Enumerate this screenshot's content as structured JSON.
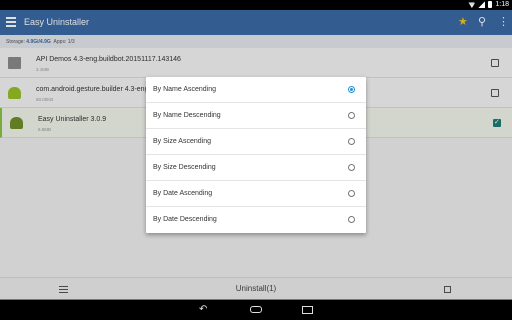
{
  "status_bar": {
    "time": "1:18"
  },
  "app_bar": {
    "title": "Easy Uninstaller"
  },
  "storage": {
    "label": "Storage",
    "value": "4.9Gi/4.9G",
    "apps_label": "Apps",
    "apps_value": "1/3"
  },
  "apps": [
    {
      "name": "API Demos 4.3-eng.buildbot.20151117.143146",
      "size": "3.1MB",
      "icon": "folder-icon",
      "checked": false
    },
    {
      "name": "com.android.gesture.builder 4.3-eng.",
      "size": "60.00KB",
      "icon": "android-icon",
      "checked": false
    },
    {
      "name": "Easy Uninstaller 3.0.9",
      "size": "6.8MB",
      "icon": "android-icon",
      "checked": true
    }
  ],
  "sort_dialog": {
    "options": [
      {
        "label": "By Name Ascending",
        "selected": true
      },
      {
        "label": "By Name Descending",
        "selected": false
      },
      {
        "label": "By Size Ascending",
        "selected": false
      },
      {
        "label": "By Size Descending",
        "selected": false
      },
      {
        "label": "By Date Ascending",
        "selected": false
      },
      {
        "label": "By Date Descending",
        "selected": false
      }
    ]
  },
  "bottom_bar": {
    "uninstall_label": "Uninstall(1)"
  },
  "colors": {
    "app_bar": "#3b6aa6",
    "accent": "#2a8fd8",
    "checkbox_on": "#1e7b74",
    "star": "#f3c41c"
  }
}
